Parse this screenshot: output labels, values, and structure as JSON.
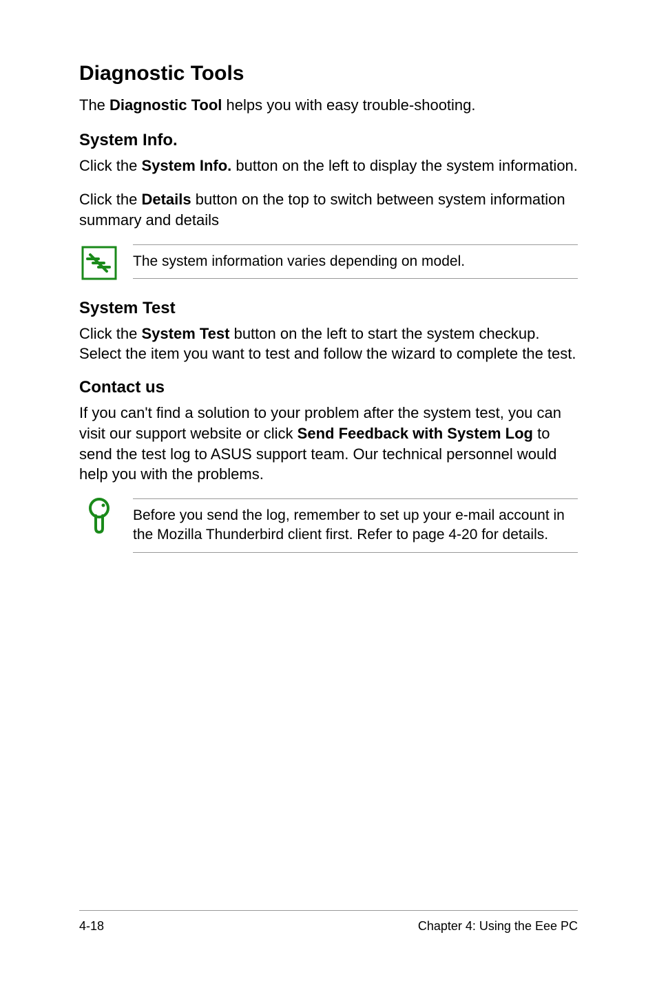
{
  "title": "Diagnostic Tools",
  "intro_pre": "The ",
  "intro_bold": "Diagnostic Tool",
  "intro_post": " helps you with easy trouble-shooting.",
  "sysinfo": {
    "heading": "System Info.",
    "p1_pre": "Click the ",
    "p1_bold": "System Info.",
    "p1_post": " button on the left to display the system information.",
    "p2_pre": "Click the ",
    "p2_bold": "Details",
    "p2_post": " button on the top to switch between system information summary and details"
  },
  "note1": "The system information varies depending on model.",
  "systest": {
    "heading": "System Test",
    "p_pre": "Click the ",
    "p_bold": "System Test",
    "p_post": " button on the left to start the system checkup. Select the item you want to test and follow the wizard to complete the test."
  },
  "contact": {
    "heading": "Contact us",
    "p_pre": "If you can't find a solution to your problem after the system test, you can visit our support website or click ",
    "p_bold": "Send Feedback with System Log",
    "p_post": " to send the test log to ASUS support team. Our technical personnel would help you with the problems."
  },
  "note2": "Before you send the log, remember to set up your e-mail account in the Mozilla Thunderbird client first. Refer to page 4-20 for details.",
  "footer": {
    "left": "4-18",
    "right": "Chapter 4: Using the Eee PC"
  }
}
